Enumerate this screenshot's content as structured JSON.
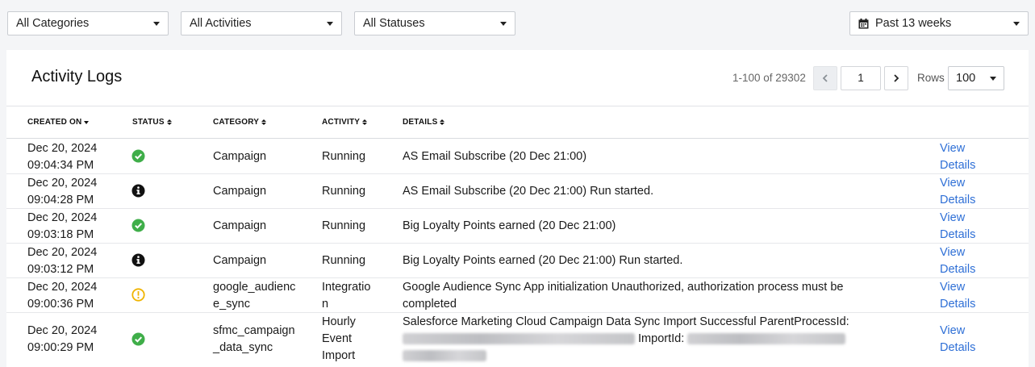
{
  "filters": {
    "categories": "All Categories",
    "activities": "All Activities",
    "statuses": "All Statuses",
    "date_range": "Past 13 weeks"
  },
  "panel": {
    "title": "Activity Logs",
    "pagination": {
      "range": "1-100 of 29302",
      "page": "1",
      "rows_label": "Rows",
      "rows_value": "100"
    }
  },
  "table": {
    "columns": [
      "CREATED ON",
      "STATUS",
      "CATEGORY",
      "ACTIVITY",
      "DETAILS"
    ],
    "rows": [
      {
        "date": "Dec 20, 2024",
        "time": "09:04:34 PM",
        "status": "success",
        "category": "Campaign",
        "activity": "Running",
        "details": "AS Email Subscribe (20 Dec 21:00)",
        "action1": "View",
        "action2": "Details"
      },
      {
        "date": "Dec 20, 2024",
        "time": "09:04:28 PM",
        "status": "info",
        "category": "Campaign",
        "activity": "Running",
        "details": "AS Email Subscribe (20 Dec 21:00) Run started.",
        "action1": "View",
        "action2": "Details"
      },
      {
        "date": "Dec 20, 2024",
        "time": "09:03:18 PM",
        "status": "success",
        "category": "Campaign",
        "activity": "Running",
        "details": "Big Loyalty Points earned (20 Dec 21:00)",
        "action1": "View",
        "action2": "Details"
      },
      {
        "date": "Dec 20, 2024",
        "time": "09:03:12 PM",
        "status": "info",
        "category": "Campaign",
        "activity": "Running",
        "details": "Big Loyalty Points earned (20 Dec 21:00) Run started.",
        "action1": "View",
        "action2": "Details"
      },
      {
        "date": "Dec 20, 2024",
        "time": "09:00:36 PM",
        "status": "warning",
        "category_l1": "google_audienc",
        "category_l2": "e_sync",
        "activity_l1": "Integratio",
        "activity_l2": "n",
        "details_l1": "Google Audience Sync App initialization Unauthorized, authorization process must be",
        "details_l2": "completed",
        "action1": "View",
        "action2": "Details"
      },
      {
        "date": "Dec 20, 2024",
        "time": "09:00:29 PM",
        "status": "success",
        "category_l1": "sfmc_campaign",
        "category_l2": "_data_sync",
        "activity_l1": "Hourly",
        "activity_l2": "Event",
        "activity_l3": "Import",
        "details_l1": "Salesforce Marketing Cloud Campaign Data Sync Import Successful ParentProcessId:",
        "details_mid": "ImportId:",
        "action1": "View",
        "action2": "Details"
      }
    ]
  },
  "colors": {
    "success": "#3fae49",
    "info": "#111111",
    "warning": "#f0b400",
    "link": "#2e6fd6"
  }
}
